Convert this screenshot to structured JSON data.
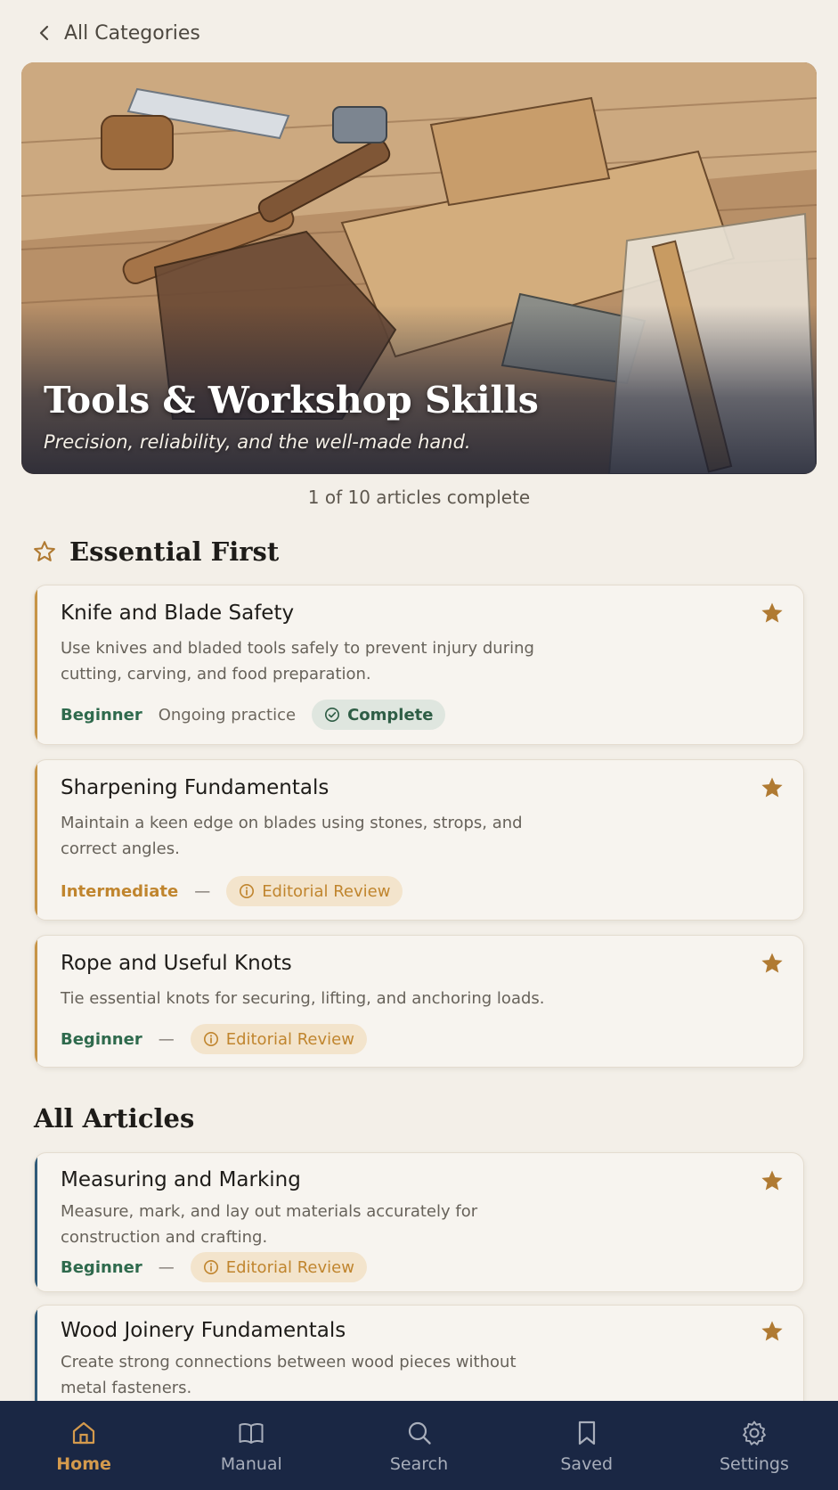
{
  "nav": {
    "back_label": "All Categories"
  },
  "hero": {
    "title": "Tools & Workshop Skills",
    "subtitle": "Precision, reliability, and the well-made hand."
  },
  "progress": {
    "text": "1 of 10 articles complete"
  },
  "essential": {
    "heading": "Essential First",
    "cards": [
      {
        "title": "Knife and Blade Safety",
        "desc": "Use knives and bladed tools safely to prevent injury during cutting, carving, and food preparation.",
        "level": "Beginner",
        "duration": "Ongoing practice",
        "status": "Complete"
      },
      {
        "title": "Sharpening Fundamentals",
        "desc": "Maintain a keen edge on blades using stones, strops, and correct angles.",
        "level": "Intermediate",
        "duration": "—",
        "status": "Editorial Review"
      },
      {
        "title": "Rope and Useful Knots",
        "desc": "Tie essential knots for securing, lifting, and anchoring loads.",
        "level": "Beginner",
        "duration": "—",
        "status": "Editorial Review"
      }
    ]
  },
  "all_articles": {
    "heading": "All Articles",
    "cards": [
      {
        "title": "Measuring and Marking",
        "desc": "Measure, mark, and lay out materials accurately for construction and crafting.",
        "level": "Beginner",
        "duration": "—",
        "status": "Editorial Review"
      },
      {
        "title": "Wood Joinery Fundamentals",
        "desc": "Create strong connections between wood pieces without metal fasteners."
      }
    ]
  },
  "tabbar": {
    "tabs": [
      {
        "label": "Home",
        "icon": "home-icon"
      },
      {
        "label": "Manual",
        "icon": "book-icon"
      },
      {
        "label": "Search",
        "icon": "search-icon"
      },
      {
        "label": "Saved",
        "icon": "bookmark-icon"
      },
      {
        "label": "Settings",
        "icon": "gear-icon"
      }
    ],
    "active": "Home"
  },
  "colors": {
    "background": "#f3efe8",
    "accent_gold": "#c79446",
    "beginner_green": "#2f6a4d",
    "intermediate_orange": "#c0852e",
    "tabbar_navy": "#1a2744"
  }
}
